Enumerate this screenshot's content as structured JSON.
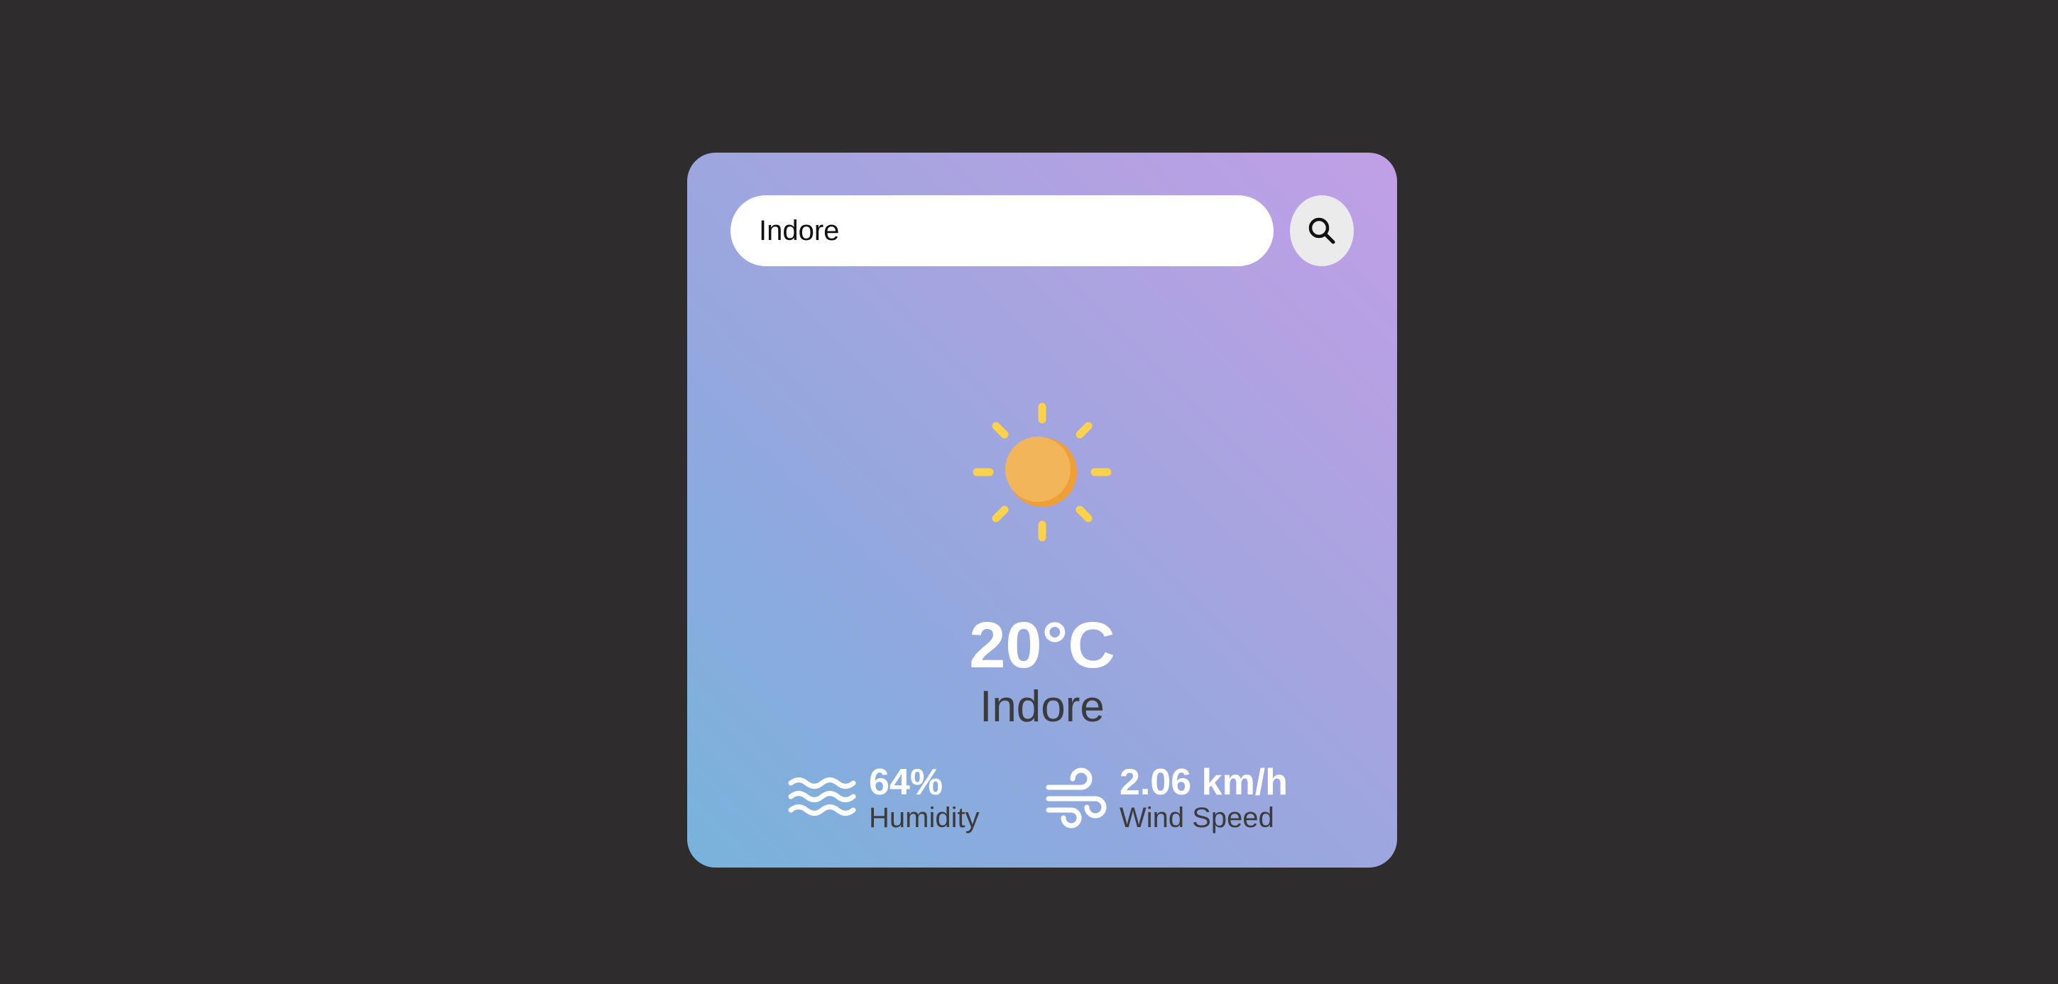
{
  "search": {
    "value": "Indore",
    "button_icon": "search-icon"
  },
  "weather": {
    "condition_icon": "sun-icon",
    "temperature": "20°C",
    "city": "Indore"
  },
  "details": {
    "humidity": {
      "icon": "waves-icon",
      "value": "64%",
      "label": "Humidity"
    },
    "wind": {
      "icon": "wind-icon",
      "value": "2.06 km/h",
      "label": "Wind Speed"
    }
  },
  "colors": {
    "page_background": "#2e2c2d",
    "card_gradient_start": "#c19fe6",
    "card_gradient_end": "#78b3dc",
    "sun_core": "#f3b352",
    "sun_rays": "#fbd249",
    "primary_text": "#ffffff",
    "secondary_text": "#3b3b3b"
  }
}
